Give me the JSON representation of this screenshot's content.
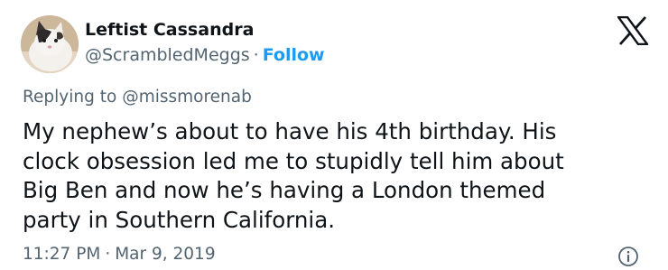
{
  "author": {
    "display_name": "Leftist Cassandra",
    "handle": "@ScrambledMeggs",
    "separator": "·",
    "follow_label": "Follow"
  },
  "reply": {
    "prefix": "Replying to",
    "mention": "@missmorenab"
  },
  "tweet": {
    "lines": [
      "My nephew’s about to have his 4th birthday. His",
      "clock obsession led me to stupidly tell him about",
      "Big Ben and now he’s having a London themed",
      "party in Southern California."
    ]
  },
  "meta": {
    "time": "11:27 PM",
    "separator": "·",
    "date": "Mar 9, 2019"
  },
  "icons": {
    "brand": "x-logo-icon",
    "info": "info-icon",
    "avatar": "cat-avatar"
  },
  "colors": {
    "text_primary": "#0f1419",
    "text_secondary": "#536471",
    "accent": "#1d9bf0",
    "background": "#ffffff"
  }
}
